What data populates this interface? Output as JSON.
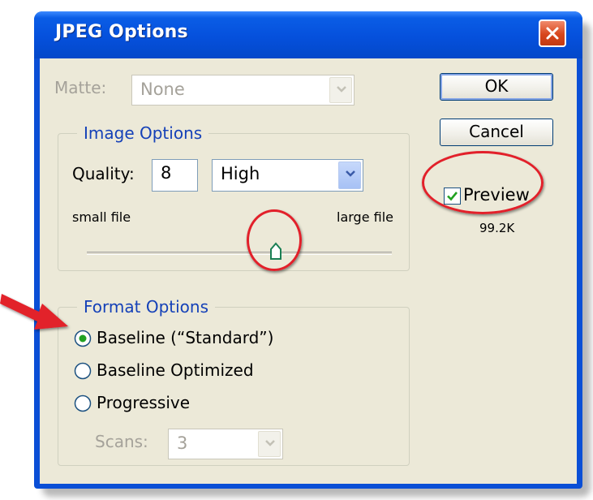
{
  "window": {
    "title": "JPEG Options"
  },
  "matte": {
    "label": "Matte:",
    "value": "None"
  },
  "image_options": {
    "legend": "Image Options",
    "quality_label": "Quality:",
    "quality_value": "8",
    "quality_preset": "High",
    "small_label": "small file",
    "large_label": "large file",
    "slider_value_fraction": 0.67
  },
  "format_options": {
    "legend": "Format Options",
    "options": [
      "Baseline (“Standard”)",
      "Baseline Optimized",
      "Progressive"
    ],
    "selected_index": 0,
    "scans_label": "Scans:",
    "scans_value": "3"
  },
  "buttons": {
    "ok": "OK",
    "cancel": "Cancel"
  },
  "preview": {
    "label": "Preview",
    "checked": true,
    "size": "99.2K"
  },
  "colors": {
    "titlebar": "#0550dc",
    "dialog_bg": "#ece9d8",
    "group_label": "#1541b8",
    "annotation": "#e2202a",
    "close_button": "#d8461c"
  },
  "icons": {
    "close": "close-icon",
    "dropdown": "chevron-down-icon",
    "check": "checkmark-icon",
    "slider": "slider-thumb-icon",
    "annotation_arrow": "arrow-right-icon"
  }
}
